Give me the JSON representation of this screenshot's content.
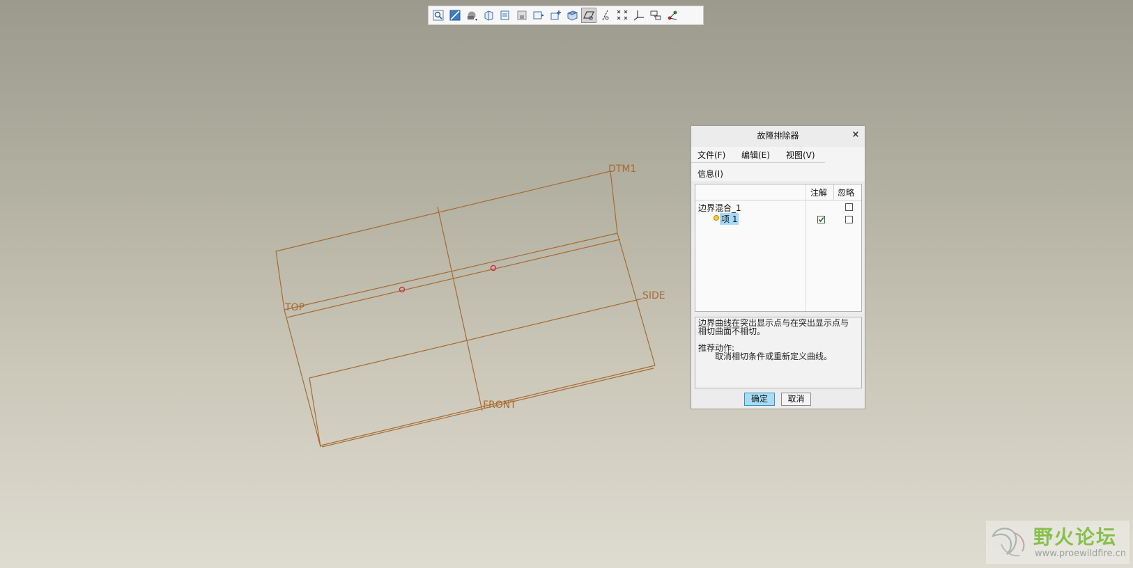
{
  "toolbar": {
    "icons": [
      "zoom-icon",
      "sketch-view-icon",
      "shading-icon",
      "view-box-icon",
      "view-manager-icon",
      "saved-orientation-icon",
      "refit-icon",
      "repaint-icon",
      "display-style-icon",
      "datum-plane-display-icon",
      "datum-axis-display-icon",
      "point-display-icon",
      "csys-display-icon",
      "annotation-display-icon",
      "spin-center-icon"
    ],
    "active_icon": "datum-plane-display-icon"
  },
  "viewport": {
    "datum_labels": [
      "DTM1",
      "TOP",
      "SIDE",
      "FRONT"
    ],
    "line_color": "#a86a30",
    "marker_color": "#d8203a"
  },
  "dialog": {
    "title": "故障排除器",
    "close": "×",
    "menu": {
      "file": "文件(F)",
      "edit": "编辑(E)",
      "view": "视图(V)",
      "info": "信息(I)"
    },
    "columns": {
      "note": "注解",
      "ignore": "忽略"
    },
    "tree": {
      "root": "边界混合_1",
      "child": "项 1",
      "child_note_checked": true,
      "child_ignore_checked": false,
      "root_ignore_checked": false
    },
    "message": {
      "line1": "边界曲线在突出显示点与在突出显示点与",
      "line2": "相切曲面不相切。",
      "action_title": "推荐动作:",
      "action_text": "取消相切条件或重新定义曲线。"
    },
    "buttons": {
      "ok": "确定",
      "cancel": "取消"
    }
  },
  "watermark": {
    "title": "野火论坛",
    "url": "www.proewildfire.cn"
  }
}
